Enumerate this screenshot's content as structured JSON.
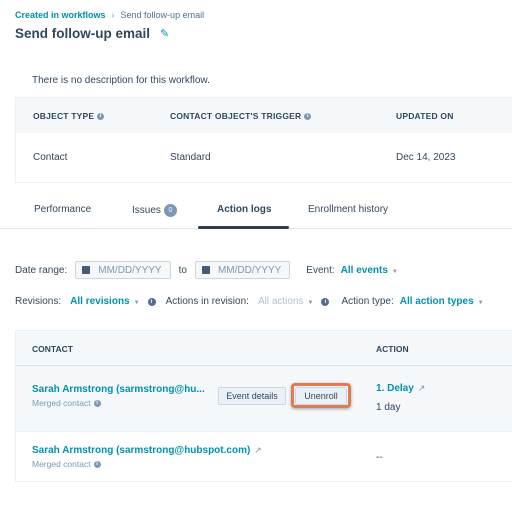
{
  "breadcrumb": {
    "parent": "Created in workflows",
    "separator": "›",
    "current": "Send follow-up email"
  },
  "header": {
    "title": "Send follow-up email",
    "edit_icon": "pencil-icon"
  },
  "description": "There is no description for this workflow.",
  "details_table": {
    "headers": [
      "OBJECT TYPE",
      "CONTACT OBJECT'S TRIGGER",
      "UPDATED ON"
    ],
    "row": [
      "Contact",
      "Standard",
      "Dec 14, 2023"
    ]
  },
  "tabs": [
    {
      "label": "Performance",
      "active": false
    },
    {
      "label": "Issues",
      "badge": "0",
      "active": false
    },
    {
      "label": "Action logs",
      "active": true
    },
    {
      "label": "Enrollment history",
      "active": false
    }
  ],
  "filters": {
    "date_range_label": "Date range:",
    "date_from_placeholder": "MM/DD/YYYY",
    "to_label": "to",
    "date_to_placeholder": "MM/DD/YYYY",
    "event_label": "Event:",
    "event_value": "All events",
    "revisions_label": "Revisions:",
    "revisions_value": "All revisions",
    "actions_label": "Actions in revision:",
    "actions_value": "All actions",
    "action_type_label": "Action type:",
    "action_type_value": "All action types"
  },
  "log_table": {
    "headers": [
      "CONTACT",
      "ACTION"
    ],
    "rows": [
      {
        "contact": "Sarah Armstrong (sarmstrong@hu...",
        "subtext": "Merged contact",
        "event_details_label": "Event details",
        "unenroll_label": "Unenroll",
        "action": "1. Delay",
        "action_detail": "1 day"
      },
      {
        "contact": "Sarah Armstrong (sarmstrong@hubspot.com)",
        "subtext": "Merged contact",
        "action": "--"
      }
    ]
  },
  "colors": {
    "link": "#0091ae",
    "text": "#33475b",
    "highlight": "#e07a50"
  }
}
